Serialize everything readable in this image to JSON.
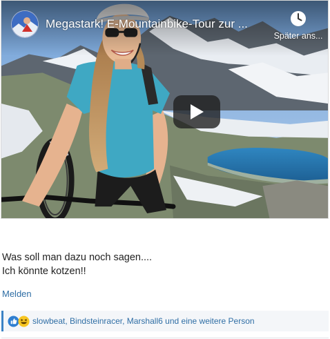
{
  "video": {
    "title": "Megastark! E-Mountainbike-Tour zur ...",
    "watch_later": "Später ans...",
    "play_icon": "play-icon",
    "clock_icon": "clock-icon"
  },
  "post": {
    "line1": "Was soll man dazu noch sagen....",
    "line2": "Ich könnte kotzen!!",
    "report": "Melden"
  },
  "reactions": {
    "icons": [
      "like-icon",
      "haha-icon"
    ],
    "users": [
      "slowbeat",
      "Bindsteinracer",
      "Marshall6"
    ],
    "separator": ", ",
    "and_text": "und",
    "more_text": "eine weitere Person"
  },
  "colors": {
    "link": "#2f6ea5",
    "play_bg": "#212121",
    "reaction_accent": "#3b82c4"
  }
}
